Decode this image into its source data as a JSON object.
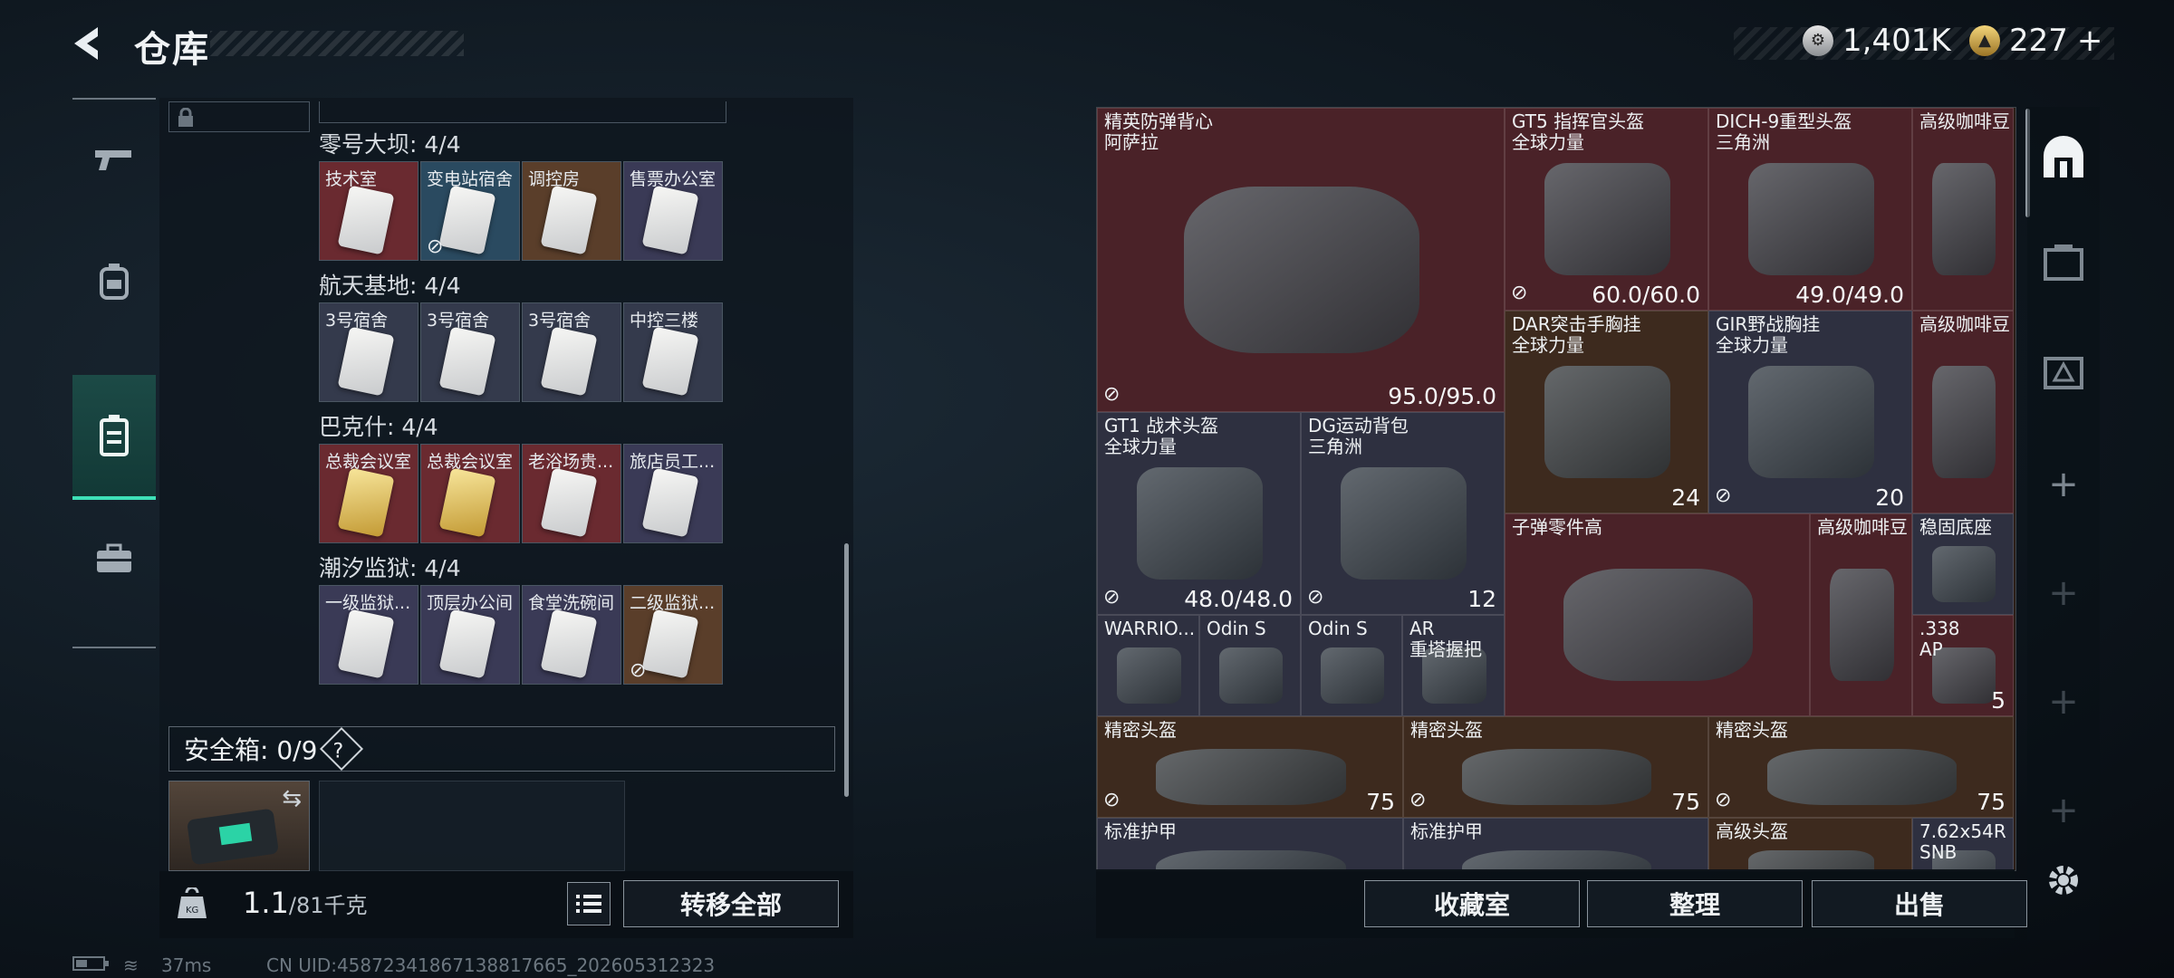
{
  "header": {
    "title": "仓库",
    "currency": [
      {
        "icon": "silver-coin-icon",
        "value": "1,401K"
      },
      {
        "icon": "gold-coin-icon",
        "value": "227"
      }
    ],
    "add_label": "+"
  },
  "left_rail": {
    "items": [
      {
        "icon": "gun-icon",
        "active": false
      },
      {
        "icon": "backpack-icon",
        "active": false
      },
      {
        "icon": "locker-icon",
        "active": true
      },
      {
        "icon": "briefcase-icon",
        "active": false
      }
    ]
  },
  "keycard_sections": [
    {
      "title": "零号大坝: 4/4",
      "cards": [
        {
          "label": "技术室",
          "color": "#6a2a30",
          "locked": false
        },
        {
          "label": "变电站宿舍",
          "color": "#2a4a60",
          "locked": true
        },
        {
          "label": "调控房",
          "color": "#5a3e2a",
          "locked": false
        },
        {
          "label": "售票办公室",
          "color": "#3a3a56",
          "locked": false
        }
      ]
    },
    {
      "title": "航天基地: 4/4",
      "cards": [
        {
          "label": "3号宿舍",
          "color": "#343a4c",
          "locked": false
        },
        {
          "label": "3号宿舍",
          "color": "#343a4c",
          "locked": false
        },
        {
          "label": "3号宿舍",
          "color": "#343a4c",
          "locked": false
        },
        {
          "label": "中控三楼",
          "color": "#343a4c",
          "locked": false
        }
      ]
    },
    {
      "title": "巴克什: 4/4",
      "cards": [
        {
          "label": "总裁会议室",
          "color": "#6a2a30",
          "locked": false,
          "gold": true
        },
        {
          "label": "总裁会议室",
          "color": "#6a2a30",
          "locked": false,
          "gold": true
        },
        {
          "label": "老浴场贵...",
          "color": "#6a2a30",
          "locked": false
        },
        {
          "label": "旅店员工...",
          "color": "#3a3a56",
          "locked": false
        }
      ]
    },
    {
      "title": "潮汐监狱: 4/4",
      "cards": [
        {
          "label": "一级监狱...",
          "color": "#3a3a56",
          "locked": false
        },
        {
          "label": "顶层办公间",
          "color": "#3a3a56",
          "locked": false
        },
        {
          "label": "食堂洗碗间",
          "color": "#3a3a56",
          "locked": false
        },
        {
          "label": "二级监狱...",
          "color": "#5a3e2a",
          "locked": true
        }
      ]
    }
  ],
  "safebox": {
    "label": "安全箱: 0/9",
    "help": "?"
  },
  "footer_left": {
    "weight": "1.1",
    "weight_unit": "/81千克",
    "transfer_all": "转移全部"
  },
  "stash": {
    "items": [
      {
        "name": "精英防弹背心\n阿萨拉",
        "value": "95.0/95.0",
        "bg": "red",
        "locked": true
      },
      {
        "name": "GT5 指挥官头盔\n全球力量",
        "value": "60.0/60.0",
        "bg": "red",
        "locked": true
      },
      {
        "name": "DICH-9重型头盔\n三角洲",
        "value": "49.0/49.0",
        "bg": "red",
        "locked": false
      },
      {
        "name": "高级咖啡豆",
        "value": "",
        "bg": "red",
        "locked": false
      },
      {
        "name": "DAR突击手胸挂\n全球力量",
        "value": "24",
        "bg": "brown",
        "locked": false
      },
      {
        "name": "GIR野战胸挂\n全球力量",
        "value": "20",
        "bg": "blue",
        "locked": true
      },
      {
        "name": "高级咖啡豆",
        "value": "",
        "bg": "red",
        "locked": false
      },
      {
        "name": "GT1 战术头盔\n全球力量",
        "value": "48.0/48.0",
        "bg": "blue",
        "locked": true
      },
      {
        "name": "DG运动背包\n三角洲",
        "value": "12",
        "bg": "blue",
        "locked": true
      },
      {
        "name": "子弹零件高",
        "value": "",
        "bg": "red",
        "locked": false
      },
      {
        "name": "高级咖啡豆",
        "value": "",
        "bg": "red",
        "locked": false
      },
      {
        "name": "稳固底座",
        "value": "",
        "bg": "blue",
        "locked": false
      },
      {
        "name": "WARRIO...",
        "value": "",
        "bg": "blue",
        "locked": false
      },
      {
        "name": "Odin S",
        "value": "",
        "bg": "blue",
        "locked": false
      },
      {
        "name": "Odin S",
        "value": "",
        "bg": "blue",
        "locked": false
      },
      {
        "name": "AR\n重塔握把",
        "value": "",
        "bg": "blue",
        "locked": false
      },
      {
        "name": ".338\nAP",
        "value": "5",
        "bg": "red",
        "locked": false
      },
      {
        "name": "精密头盔",
        "value": "75",
        "bg": "brown",
        "locked": true
      },
      {
        "name": "精密头盔",
        "value": "75",
        "bg": "brown",
        "locked": true
      },
      {
        "name": "精密头盔",
        "value": "75",
        "bg": "brown",
        "locked": true
      },
      {
        "name": "标准护甲",
        "value": "",
        "bg": "blue",
        "locked": false
      },
      {
        "name": "标准护甲",
        "value": "",
        "bg": "blue",
        "locked": false
      },
      {
        "name": "高级头盔",
        "value": "",
        "bg": "brown",
        "locked": false
      },
      {
        "name": "7.62x54R\nSNB",
        "value": "",
        "bg": "blue",
        "locked": false
      }
    ]
  },
  "footer_right": {
    "collection": "收藏室",
    "sort": "整理",
    "sell": "出售"
  },
  "right_rail": {
    "icons": [
      "shelter-icon",
      "crate-icon",
      "crate-icon",
      "plus-icon",
      "plus-icon",
      "plus-icon",
      "plus-icon",
      "settings-icon"
    ]
  },
  "status_bar": {
    "ping": "37ms",
    "uid": "CN UID:4587234186713881766​5_202605312323"
  }
}
